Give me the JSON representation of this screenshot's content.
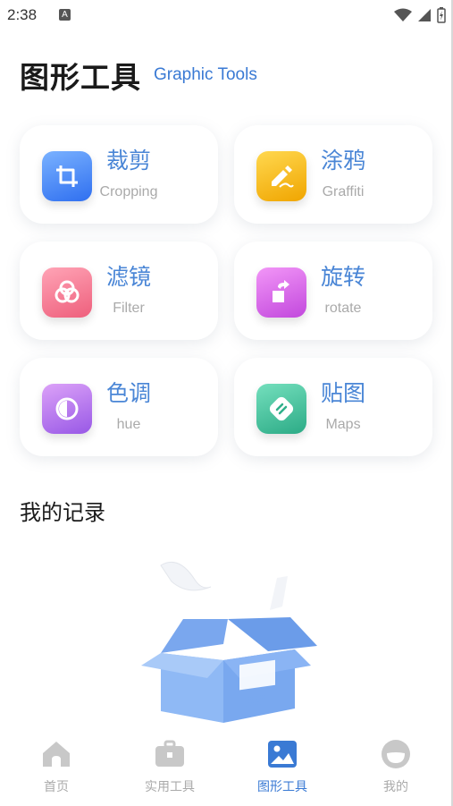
{
  "status_bar": {
    "time": "2:38",
    "notification_badge": "A"
  },
  "header": {
    "title": "图形工具",
    "subtitle": "Graphic Tools"
  },
  "tools": [
    {
      "name": "裁剪",
      "en": "Cropping",
      "icon": "crop-icon",
      "color_from": "#6aa8ff",
      "color_to": "#2f72f0"
    },
    {
      "name": "涂鸦",
      "en": "Graffiti",
      "icon": "pen-icon",
      "color_from": "#ffd24a",
      "color_to": "#f2a900"
    },
    {
      "name": "滤镜",
      "en": "Filter",
      "icon": "filter-icon",
      "color_from": "#ff9eb0",
      "color_to": "#f0607c"
    },
    {
      "name": "旋转",
      "en": "rotate",
      "icon": "rotate-icon",
      "color_from": "#f08cf5",
      "color_to": "#c64ae0"
    },
    {
      "name": "色调",
      "en": "hue",
      "icon": "hue-icon",
      "color_from": "#d79cf7",
      "color_to": "#9c5ee8"
    },
    {
      "name": "贴图",
      "en": "Maps",
      "icon": "sticker-icon",
      "color_from": "#6fdcb8",
      "color_to": "#2fb08a"
    }
  ],
  "records": {
    "title": "我的记录"
  },
  "nav": {
    "items": [
      {
        "label": "首页",
        "icon": "home-icon"
      },
      {
        "label": "实用工具",
        "icon": "toolbox-icon"
      },
      {
        "label": "图形工具",
        "icon": "image-icon",
        "active": true
      },
      {
        "label": "我的",
        "icon": "profile-icon"
      }
    ]
  },
  "colors": {
    "accent": "#3a7ad4",
    "inactive": "#c8c8c8"
  }
}
